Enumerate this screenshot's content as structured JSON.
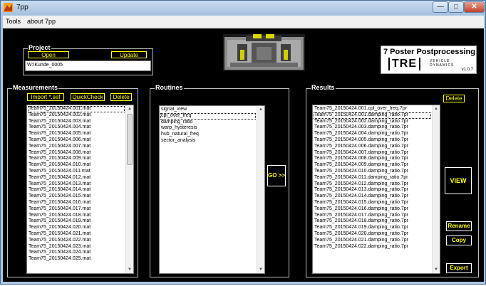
{
  "window": {
    "title": "7pp",
    "controls": {
      "minimize": "—",
      "maximize": "□",
      "close": "✕"
    }
  },
  "menu": {
    "items": [
      "Tools",
      "about 7pp"
    ]
  },
  "project": {
    "title": "Project",
    "open_label": "Open",
    "update_label": "Update",
    "path_value": "W:\\Kunde_0005"
  },
  "logo": {
    "title": "7 Poster Postprocessing",
    "brand": "TRE",
    "subtitle_line1": "VEHICLE",
    "subtitle_line2": "DYNAMICS",
    "version": "v1.0.7"
  },
  "measurements": {
    "title": "Measurements",
    "import_label": "Import *.sef",
    "quickcheck_label": "QuickCheck",
    "delete_label": "Delete",
    "items": [
      "Team75_20150424.001.mat",
      "Team75_20150424.002.mat",
      "Team75_20150424.003.mat",
      "Team75_20150424.004.mat",
      "Team75_20150424.005.mat",
      "Team75_20150424.006.mat",
      "Team75_20150424.007.mat",
      "Team75_20150424.008.mat",
      "Team75_20150424.009.mat",
      "Team75_20150424.010.mat",
      "Team75_20150424.011.mat",
      "Team75_20150424.012.mat",
      "Team75_20150424.013.mat",
      "Team75_20150424.014.mat",
      "Team75_20150424.015.mat",
      "Team75_20150424.016.mat",
      "Team75_20150424.017.mat",
      "Team75_20150424.018.mat",
      "Team75_20150424.019.mat",
      "Team75_20150424.020.mat",
      "Team75_20150424.021.mat",
      "Team75_20150424.022.mat",
      "Team75_20150424.023.mat",
      "Team75_20150424.024.mat",
      "Team75_20150424.025.mat"
    ]
  },
  "routines": {
    "title": "Routines",
    "go_label": "GO >>",
    "items": [
      "signal_view",
      "cpl_over_freq",
      "damping_ratio",
      "warp_hysteresis",
      "hub_natural_freq",
      "sector_analysis"
    ]
  },
  "results": {
    "title": "Results",
    "delete_label": "Delete",
    "view_label": "VIEW",
    "rename_label": "Rename",
    "copy_label": "Copy",
    "export_label": "Export",
    "items": [
      "Team75_20150424.001.cpl_over_freq.7pr",
      "Team75_20150424.001.damping_ratio.7pr",
      "Team75_20150424.002.damping_ratio.7pr",
      "Team75_20150424.003.damping_ratio.7pr",
      "Team75_20150424.004.damping_ratio.7pr",
      "Team75_20150424.005.damping_ratio.7pr",
      "Team75_20150424.006.damping_ratio.7pr",
      "Team75_20150424.007.damping_ratio.7pr",
      "Team75_20150424.008.damping_ratio.7pr",
      "Team75_20150424.009.damping_ratio.7pr",
      "Team75_20150424.010.damping_ratio.7pr",
      "Team75_20150424.011.damping_ratio.7pr",
      "Team75_20150424.012.damping_ratio.7pr",
      "Team75_20150424.013.damping_ratio.7pr",
      "Team75_20150424.014.damping_ratio.7pr",
      "Team75_20150424.015.damping_ratio.7pr",
      "Team75_20150424.016.damping_ratio.7pr",
      "Team75_20150424.017.damping_ratio.7pr",
      "Team75_20150424.018.damping_ratio.7pr",
      "Team75_20150424.019.damping_ratio.7pr",
      "Team75_20150424.020.damping_ratio.7pr",
      "Team75_20150424.021.damping_ratio.7pr",
      "Team75_20150424.022.damping_ratio.7pr"
    ]
  },
  "colors": {
    "button_text": "#ffff00",
    "background": "#000000",
    "panel_border": "#bfbfbf"
  }
}
